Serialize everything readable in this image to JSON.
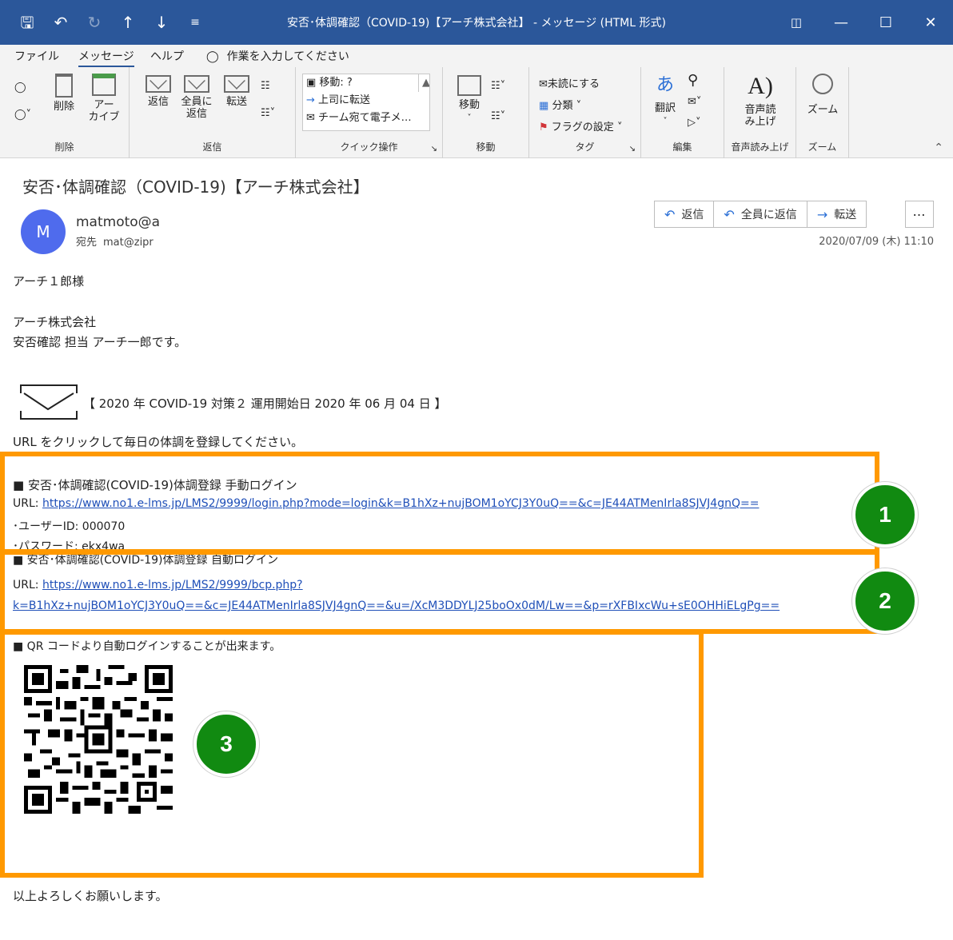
{
  "window": {
    "title": "安否･体調確認（COVID-19)【アーチ株式会社】 - メッセージ (HTML 形式)",
    "qat_icons": [
      "save-icon",
      "undo-icon",
      "redo-icon",
      "up-arrow-icon",
      "down-arrow-icon",
      "customize-icon"
    ],
    "controls": [
      "ribbon-display-icon",
      "minimize-icon",
      "maximize-icon",
      "close-icon"
    ]
  },
  "menu": {
    "tabs": [
      "ファイル",
      "メッセージ",
      "ヘルプ"
    ],
    "active_tab": "メッセージ",
    "tell_me": "作業を入力してください"
  },
  "ribbon": {
    "delete_group": {
      "label": "削除",
      "delete": "削除",
      "archive_1": "アー",
      "archive_2": "カイブ"
    },
    "respond_group": {
      "label": "返信",
      "reply": "返信",
      "reply_all_1": "全員に",
      "reply_all_2": "返信",
      "forward": "転送"
    },
    "quick_steps": {
      "label": "クイック操作",
      "items": [
        "移動: ?",
        "上司に転送",
        "チーム宛て電子メ…"
      ]
    },
    "move_group": {
      "label": "移動",
      "move": "移動"
    },
    "tags_group": {
      "label": "タグ",
      "unread": "未読にする",
      "categorize": "分類",
      "follow_up": "フラグの設定"
    },
    "edit_group": {
      "label": "編集",
      "translate": "翻訳"
    },
    "speech_group": {
      "label": "音声読み上げ",
      "read_1": "音声読",
      "read_2": "み上げ"
    },
    "zoom_group": {
      "label": "ズーム",
      "zoom": "ズーム"
    }
  },
  "message": {
    "subject": "安否･体調確認（COVID-19)【アーチ株式会社】",
    "avatar_letter": "M",
    "sender": "matmoto@a",
    "to_label": "宛先",
    "to": "mat@zipr",
    "date": "2020/07/09 (木) 11:10",
    "actions": {
      "reply": "返信",
      "reply_all": "全員に返信",
      "forward": "転送",
      "more": "…"
    }
  },
  "body": {
    "greeting": "アーチ１郎様",
    "company": "アーチ株式会社",
    "signature": "安否確認 担当 アーチ一郎です。",
    "campaign": "【 2020 年 COVID-19 対策２ 運用開始日 2020 年 06 月 04 日 】",
    "instruction": "URL をクリックして毎日の体調を登録してください。",
    "manual": {
      "heading": "■ 安否･体調確認(COVID-19)体調登録 手動ログイン",
      "url_label": "URL: ",
      "url": "https://www.no1.e-lms.jp/LMS2/9999/login.php?mode=login&k=B1hXz+nujBOM1oYCJ3Y0uQ==&c=JE44ATMenIrla8SJVJ4gnQ==",
      "user_id": "･ユーザーID: 000070",
      "password": "･パスワード: ekx4wa"
    },
    "auto": {
      "heading": "■ 安否･体調確認(COVID-19)体調登録 自動ログイン",
      "url_label": "URL: ",
      "url_line1": "https://www.no1.e-lms.jp/LMS2/9999/bcp.php?",
      "url_line2": "k=B1hXz+nujBOM1oYCJ3Y0uQ==&c=JE44ATMenIrla8SJVJ4gnQ==&u=/XcM3DDYLJ25boOx0dM/Lw==&p=rXFBIxcWu+sE0OHHiELgPg=="
    },
    "qr": {
      "heading": "■ QR コードより自動ログインすることが出来ます。"
    },
    "closing": "以上よろしくお願いします。"
  },
  "callouts": [
    "1",
    "2",
    "3"
  ],
  "colors": {
    "titlebar": "#2b579a",
    "highlight": "#ff9900",
    "badge": "#118a11",
    "link": "#1f4fb8",
    "avatar": "#4f6bed"
  }
}
